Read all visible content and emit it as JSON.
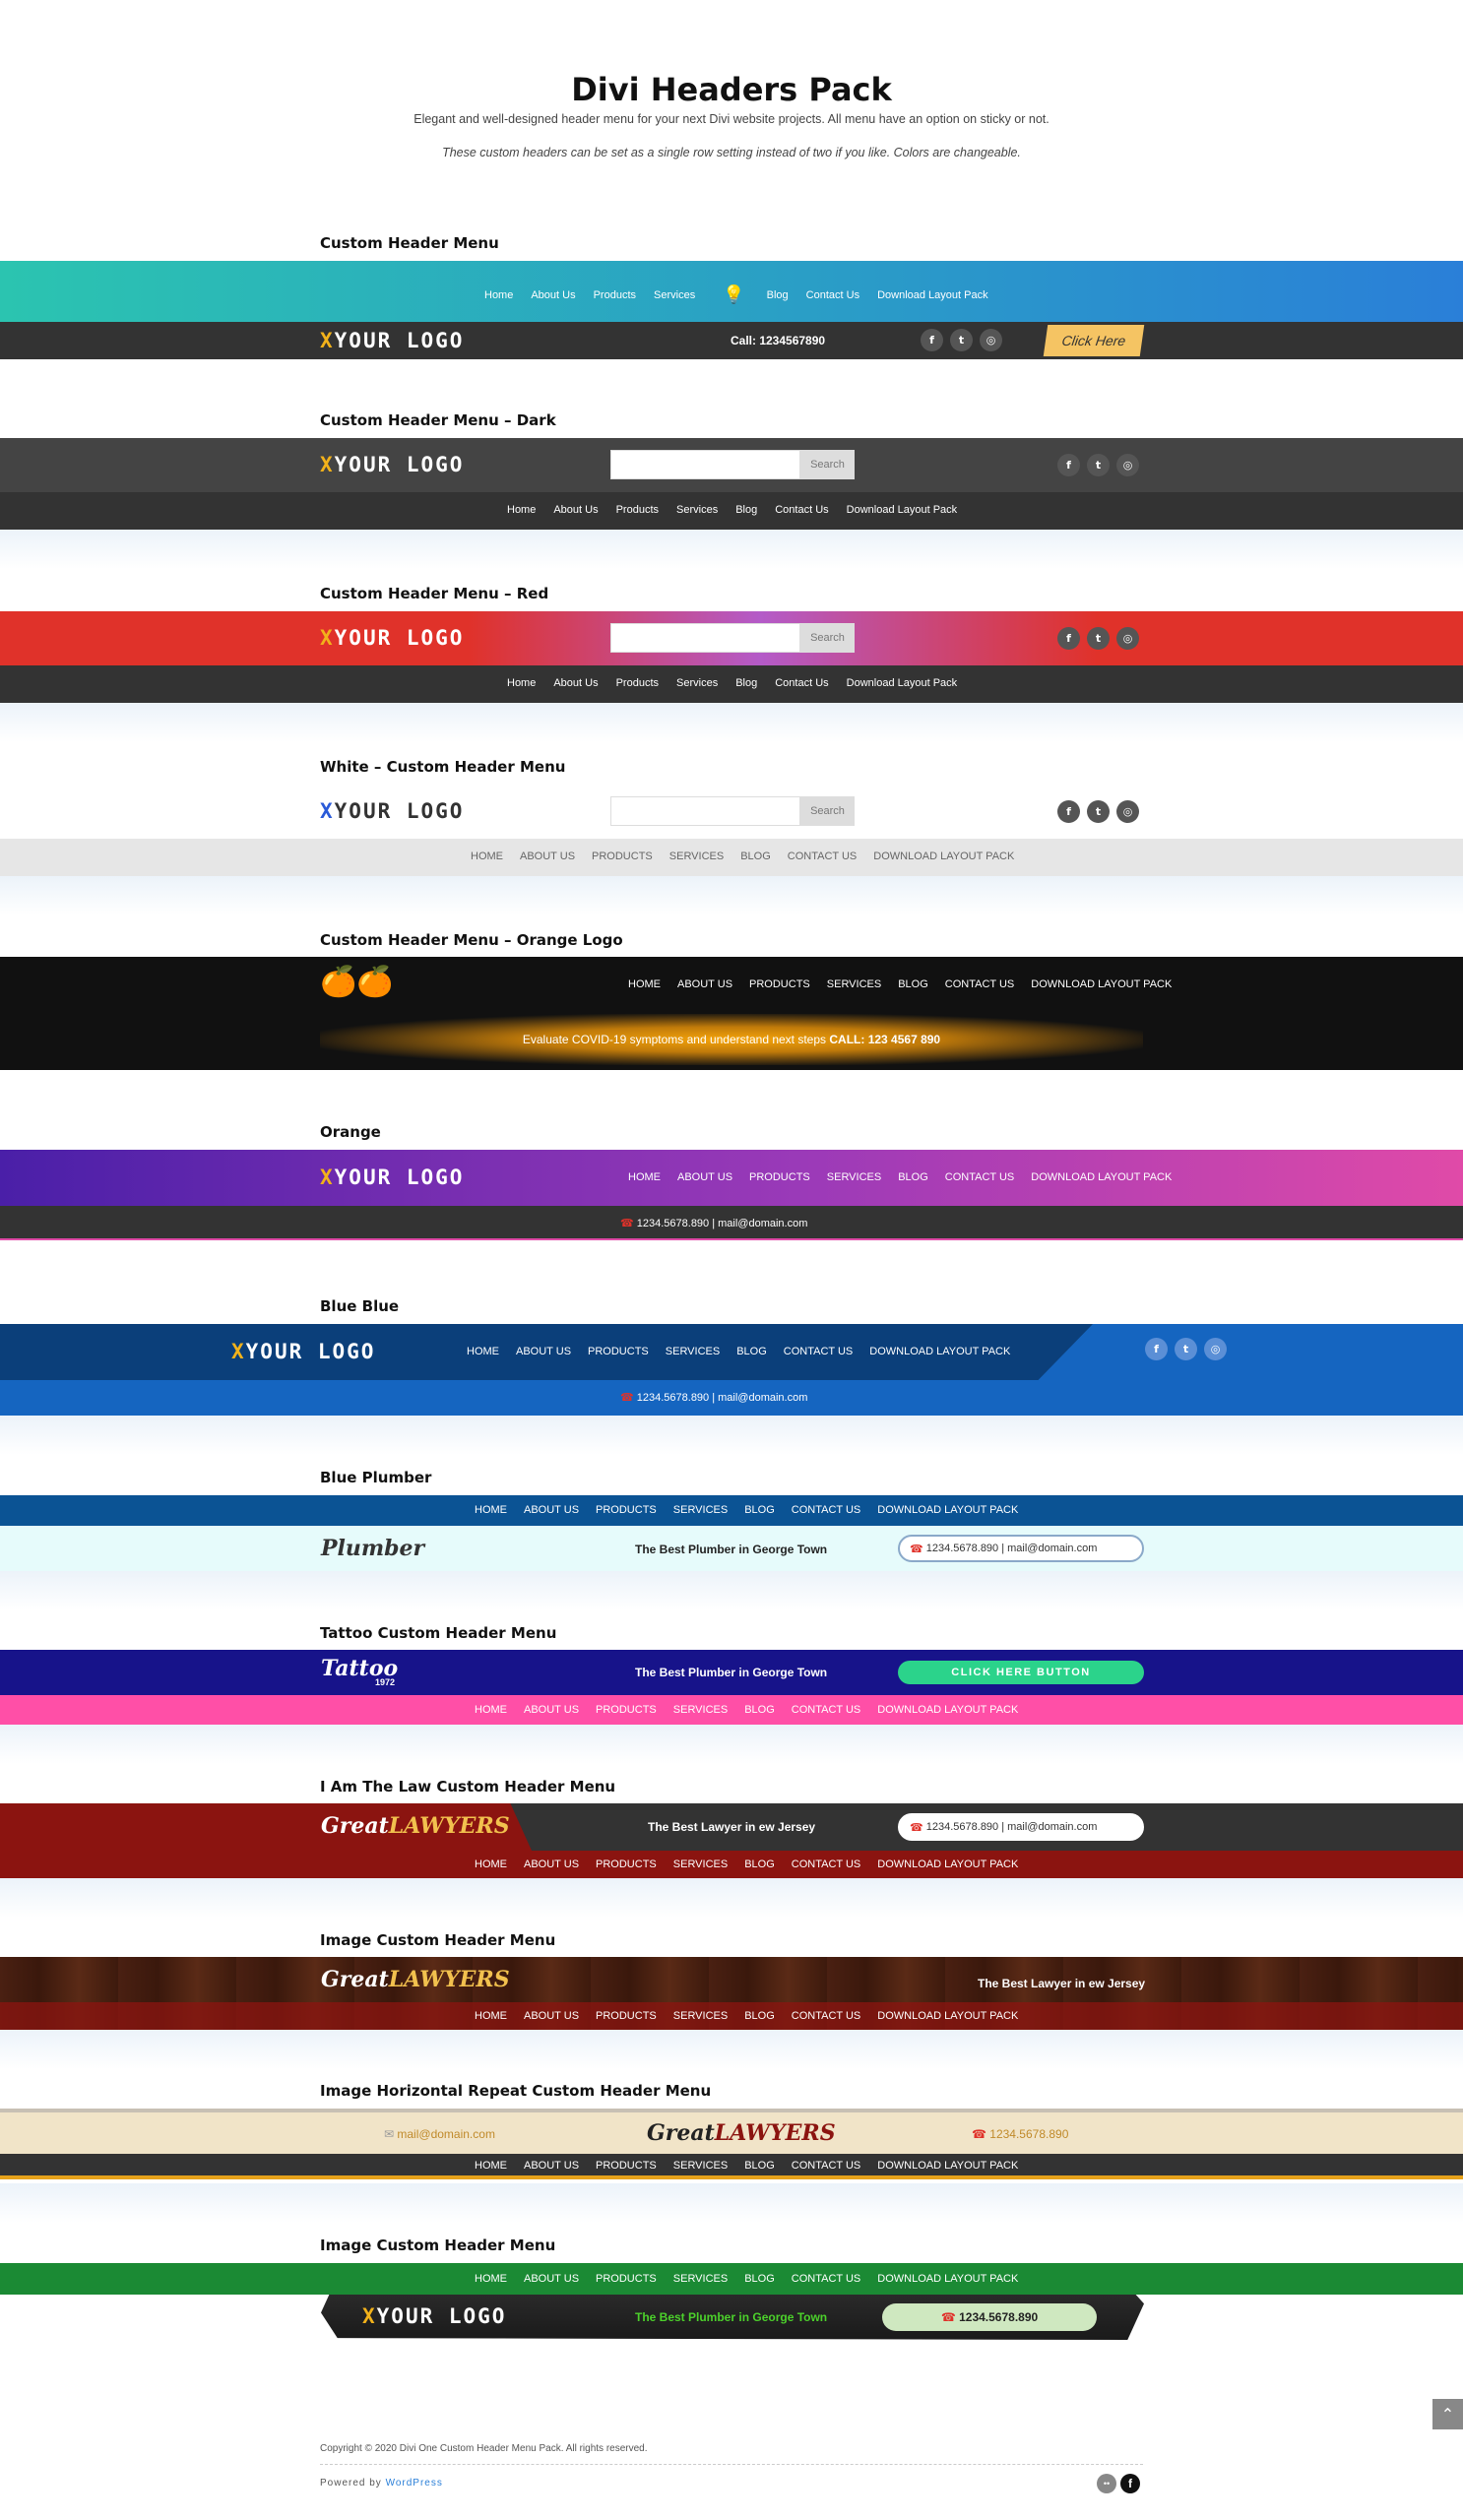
{
  "intro": {
    "title": "Divi Headers Pack",
    "subtitle": "Elegant and well-designed header menu for your next Divi website projects. All menu have an option on sticky or not.",
    "note": "These custom headers can be set as a single row setting instead of two if you like. Colors are changeable."
  },
  "logo": {
    "x": "X",
    "rest": "YOUR LOGO"
  },
  "menu": [
    "Home",
    "About Us",
    "Products",
    "Services",
    "Blog",
    "Contact Us",
    "Download Layout Pack"
  ],
  "social": {
    "facebook": "f",
    "twitter": "t",
    "instagram": "◎"
  },
  "search": {
    "placeholder": "",
    "button": "Search"
  },
  "sections": [
    {
      "title": "Custom Header Menu",
      "phone": "Call: 1234567890",
      "cta": "Click Here"
    },
    {
      "title": "Custom Header Menu – Dark"
    },
    {
      "title": "Custom Header Menu – Red"
    },
    {
      "title": "White – Custom Header Menu"
    },
    {
      "title": "Custom Header Menu – Orange Logo",
      "notice": "Evaluate COVID-19 symptoms and understand next steps",
      "notice_call": "CALL: 123 4567 890"
    },
    {
      "title": "Orange",
      "contact": "1234.5678.890 | mail@domain.com"
    },
    {
      "title": "Blue Blue",
      "contact": "1234.5678.890 | mail@domain.com"
    },
    {
      "title": "Blue Plumber",
      "logo": "Plumber",
      "tagline": "The Best Plumber in George Town",
      "contact": "1234.5678.890 | mail@domain.com"
    },
    {
      "title": "Tattoo Custom Header Menu",
      "logo": "Tattoo",
      "logo_year": "1972",
      "tagline": "The Best Plumber in George Town",
      "cta": "CLICK HERE BUTTON"
    },
    {
      "title": "I Am The Law Custom Header Menu",
      "logo_a": "Great",
      "logo_b": "LAWYERS",
      "tagline": "The Best Lawyer in ew Jersey",
      "contact": "1234.5678.890 | mail@domain.com"
    },
    {
      "title": "Image Custom Header Menu",
      "logo_a": "Great",
      "logo_b": "LAWYERS",
      "tagline": "The Best Lawyer in ew Jersey"
    },
    {
      "title": "Image Horizontal Repeat Custom Header Menu",
      "logo_a": "Great",
      "logo_b": "LAWYERS",
      "email": "mail@domain.com",
      "phone": "1234.5678.890"
    },
    {
      "title": "Image Custom Header Menu",
      "tagline": "The Best Plumber in George Town",
      "phone": "1234.5678.890"
    }
  ],
  "footer": {
    "copyright": "Copyright © 2020 Divi One Custom Header Menu Pack. All rights reserved.",
    "powered": "Powered by",
    "powered_link": "WordPress"
  },
  "colors": {
    "teal": "#2bc4b0",
    "blue": "#2a7fd8",
    "dark": "#333333",
    "red": "#e0322a",
    "purple": "#5a2bb0",
    "pink": "#e04aa8",
    "navy": "#0b3f7a",
    "tattoo": "#17138a",
    "maroon": "#8b1410",
    "green": "#1b8a34",
    "gold": "#f2b21b"
  }
}
